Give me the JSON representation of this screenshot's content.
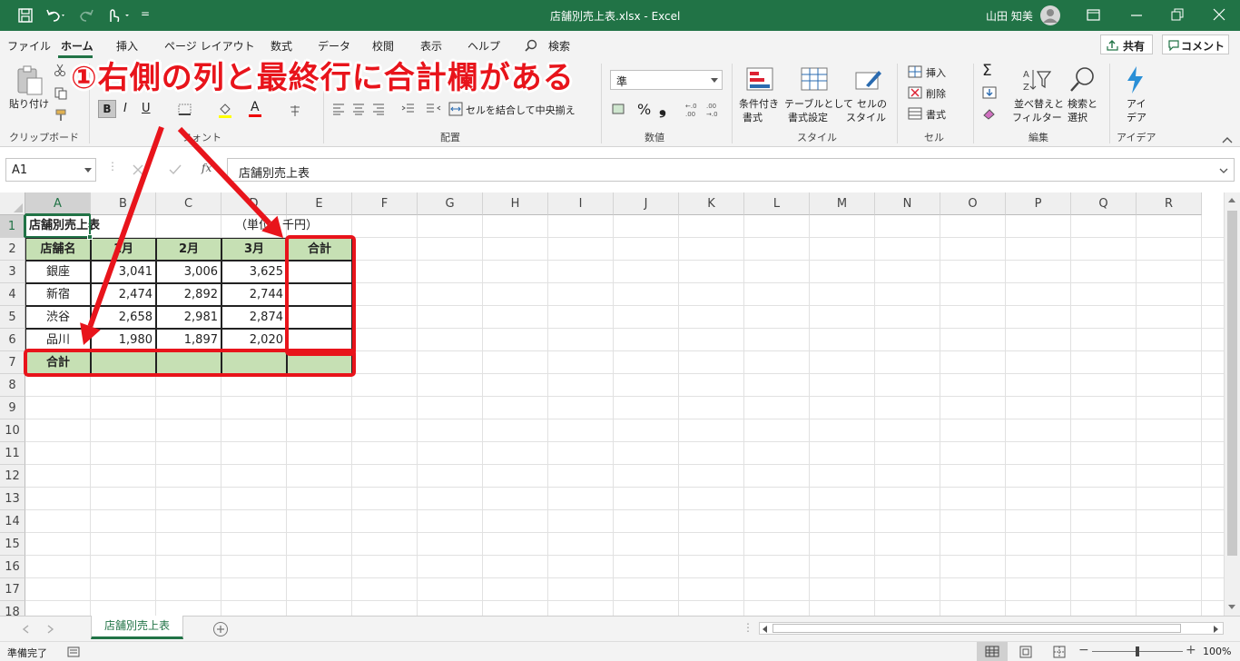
{
  "window": {
    "title": "店舗別売上表.xlsx  -  Excel",
    "user": "山田 知美"
  },
  "qat": {
    "menu_glyph": "="
  },
  "tabs": [
    "ファイル",
    "ホーム",
    "挿入",
    "ページ レイアウト",
    "数式",
    "データ",
    "校閲",
    "表示",
    "ヘルプ",
    "検索"
  ],
  "share": {
    "label": "共有"
  },
  "comment": {
    "label": "コメント"
  },
  "ribbon": {
    "paste": "貼り付け",
    "clipboard": "クリップボード",
    "font": "フォント",
    "align": "配置",
    "number": "数値",
    "styles": "スタイル",
    "cells": "セル",
    "edit": "編集",
    "ideas_group": "アイデア",
    "merge_center": "セルを結合して中央揃え",
    "number_format": "準",
    "cond_format_1": "条件付き",
    "cond_format_2": "書式",
    "table_fmt_1": "テーブルとして",
    "table_fmt_2": "書式設定",
    "cell_style_1": "セルの",
    "cell_style_2": "スタイル",
    "insert": "挿入",
    "delete": "削除",
    "format": "書式",
    "sort_1": "並べ替えと",
    "sort_2": "フィルター",
    "find_1": "検索と",
    "find_2": "選択",
    "ideas_1": "アイ",
    "ideas_2": "デア",
    "bold": "B",
    "italic": "I",
    "underline": "U",
    "percent": "%",
    "comma": "❟",
    "font_color": "A",
    "sum": "Σ"
  },
  "formula_bar": {
    "name_box": "A1",
    "fx": "fx",
    "content": "店舗別売上表"
  },
  "grid": {
    "columns": [
      "A",
      "B",
      "C",
      "D",
      "E",
      "F",
      "G",
      "H",
      "I",
      "J",
      "K",
      "L",
      "M",
      "N",
      "O",
      "P",
      "Q",
      "R"
    ],
    "rows": [
      "1",
      "2",
      "3",
      "4",
      "5",
      "6",
      "7",
      "8",
      "9",
      "10",
      "11",
      "12",
      "13",
      "14",
      "15",
      "16",
      "17",
      "18"
    ]
  },
  "table": {
    "title": "店舗別売上表",
    "unit": "（単位：千円）",
    "headers": [
      "店舗名",
      "1月",
      "2月",
      "3月",
      "合計"
    ],
    "rows": [
      {
        "store": "銀座",
        "m1": "3,041",
        "m2": "3,006",
        "m3": "3,625"
      },
      {
        "store": "新宿",
        "m1": "2,474",
        "m2": "2,892",
        "m3": "2,744"
      },
      {
        "store": "渋谷",
        "m1": "2,658",
        "m2": "2,981",
        "m3": "2,874"
      },
      {
        "store": "品川",
        "m1": "1,980",
        "m2": "1,897",
        "m3": "2,020"
      }
    ],
    "total_label": "合計"
  },
  "annotation": {
    "text": "①右側の列と最終行に合計欄がある",
    "color": "#e8141b"
  },
  "sheet_tab": {
    "name": "店舗別売上表"
  },
  "status": {
    "ready": "準備完了",
    "zoom": "100%"
  },
  "colors": {
    "accent": "#217346",
    "header_fill": "#c6e0b4"
  }
}
